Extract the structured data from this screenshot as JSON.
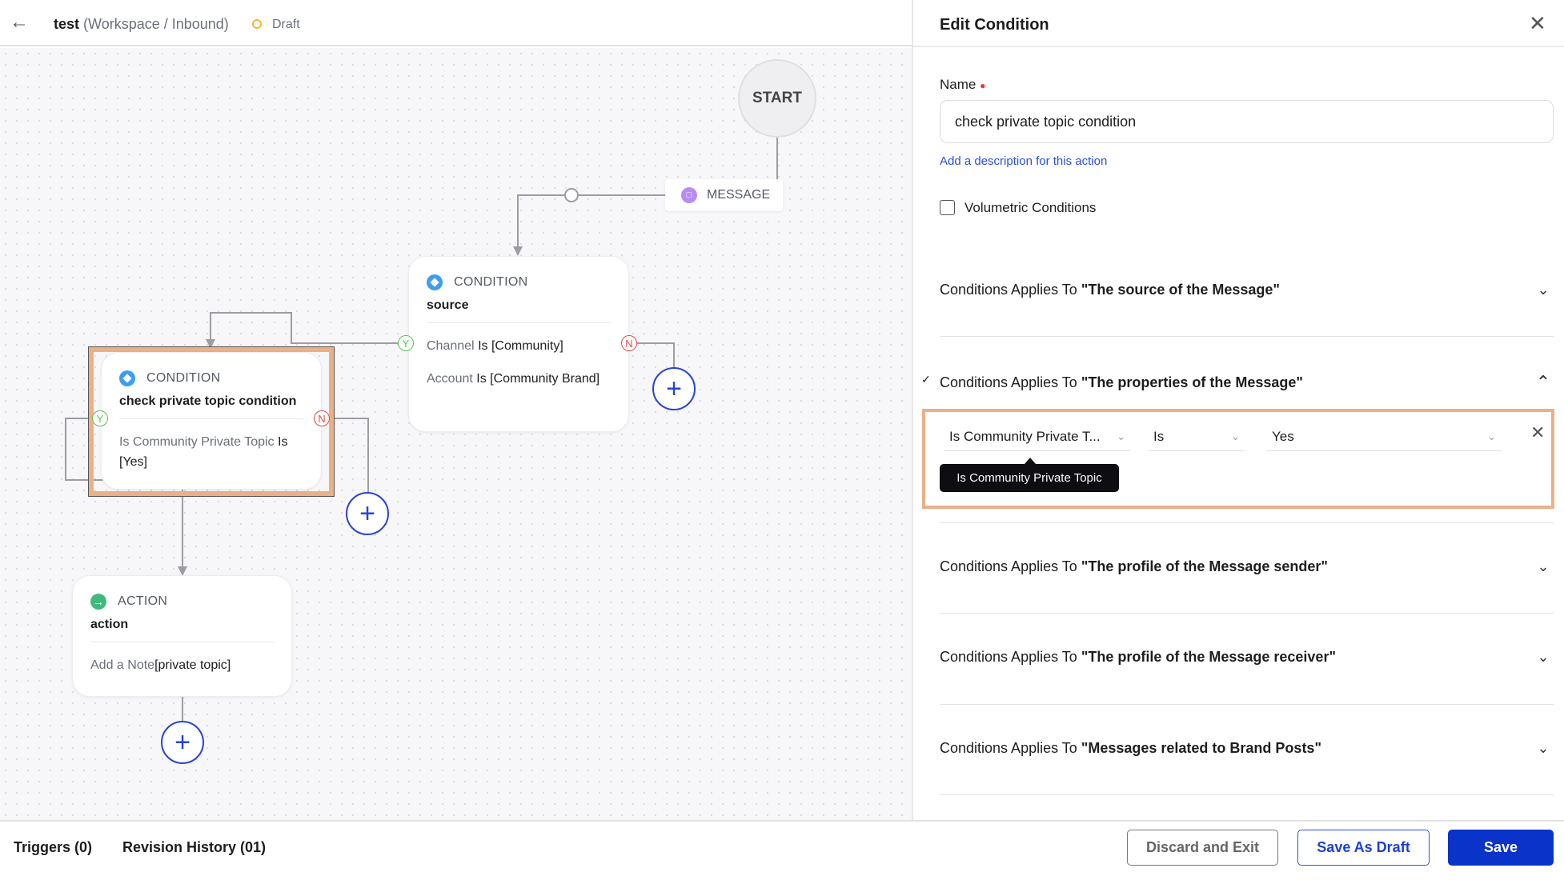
{
  "header": {
    "title": "test",
    "path": "(Workspace / Inbound)",
    "status": "Draft",
    "status_color": "#f5b83d"
  },
  "canvas": {
    "start": "START",
    "message": "MESSAGE",
    "nodes": [
      {
        "type": "CONDITION",
        "name": "source",
        "rows": [
          {
            "field": "Channel",
            "op": "Is",
            "value": "[Community]"
          },
          {
            "field": "Account",
            "op": "Is",
            "value": "[Community Brand]"
          }
        ]
      },
      {
        "type": "CONDITION",
        "name": "check private topic condition",
        "rows": [
          {
            "field": "Is Community Private Topic",
            "op": "Is",
            "value": "[Yes]"
          }
        ],
        "selected": true
      },
      {
        "type": "ACTION",
        "name": "action",
        "rows": [
          {
            "field": "Add a Note",
            "op": "",
            "value": "[private topic]"
          }
        ]
      }
    ],
    "yes": "Y",
    "no": "N"
  },
  "panel": {
    "title": "Edit Condition",
    "name_label": "Name",
    "name_value": "check private topic condition",
    "desc_link": "Add a description for this action",
    "volumetric_label": "Volumetric Conditions",
    "volumetric_checked": false,
    "section_prefix": "Conditions Applies To",
    "sections": [
      {
        "title": "\"The source of the Message\"",
        "expanded": false
      },
      {
        "title": "\"The properties of the Message\"",
        "expanded": true
      },
      {
        "title": "\"The profile of the Message sender\"",
        "expanded": false
      },
      {
        "title": "\"The profile of the Message receiver\"",
        "expanded": false
      },
      {
        "title": "\"Messages related to Brand Posts\"",
        "expanded": false
      }
    ],
    "condition_row": {
      "field": "Is Community Private T...",
      "operator": "Is",
      "value": "Yes"
    },
    "tooltip": "Is Community Private Topic"
  },
  "footer": {
    "triggers": "Triggers (0)",
    "revision": "Revision History (01)",
    "discard": "Discard and Exit",
    "save_draft": "Save As Draft",
    "save": "Save"
  },
  "colors": {
    "accent": "#0a33c9",
    "highlight": "#eab088",
    "link": "#2a4fe0"
  }
}
